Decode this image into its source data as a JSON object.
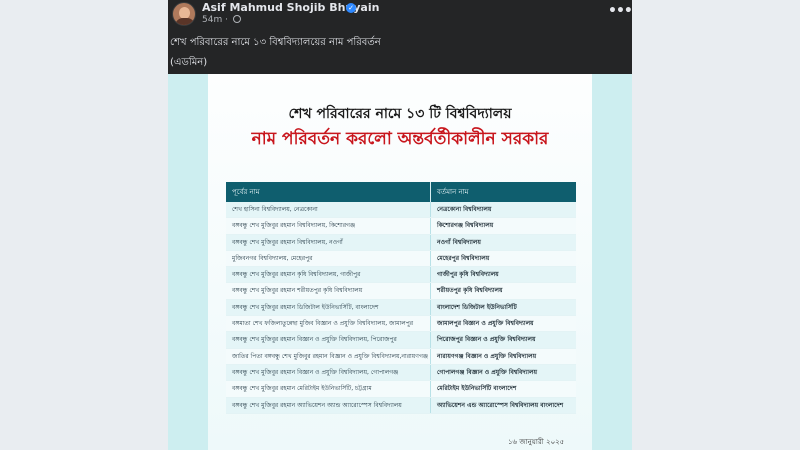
{
  "post": {
    "author": "Asif Mahmud Shojib Bhuyain",
    "time": "54m",
    "caption_line1": "শেখ পরিবারের নামে ১৩ বিশ্ববিদ্যালয়ের নাম পরিবর্তন",
    "caption_line2": "(এডমিন)",
    "more_label": "•••"
  },
  "graphic": {
    "headline1": "শেখ পরিবারের নামে ১৩ টি বিশ্ববিদ্যালয়",
    "headline2": "নাম পরিবর্তন করলো অন্তর্বর্তীকালীন সরকার",
    "headline2_color": "#c8161d",
    "header_color": "#0f5e6e",
    "col_old": "পূর্বের নাম",
    "col_new": "বর্তমান নাম",
    "rows": [
      {
        "old": "শেখ হাসিনা বিশ্ববিদ্যালয়, নেত্রকোনা",
        "new": "নেত্রকোনা বিশ্ববিদ্যালয়"
      },
      {
        "old": "বঙ্গবন্ধু শেখ মুজিবুর রহমান বিশ্ববিদ্যালয়, কিশোরগঞ্জ",
        "new": "কিশোরগঞ্জ বিশ্ববিদ্যালয়"
      },
      {
        "old": "বঙ্গবন্ধু শেখ মুজিবুর রহমান বিশ্ববিদ্যালয়, নওগাঁ",
        "new": "নওগাঁ বিশ্ববিদ্যালয়"
      },
      {
        "old": "মুজিবনগর বিশ্ববিদ্যালয়, মেহেরপুর",
        "new": "মেহেরপুর বিশ্ববিদ্যালয়"
      },
      {
        "old": "বঙ্গবন্ধু শেখ মুজিবুর রহমান কৃষি বিশ্ববিদ্যালয়, গাজীপুর",
        "new": "গাজীপুর কৃষি বিশ্ববিদ্যালয়"
      },
      {
        "old": "বঙ্গবন্ধু শেখ মুজিবুর রহমান শরীয়তপুর কৃষি বিশ্ববিদ্যালয়",
        "new": "শরীয়তপুর কৃষি বিশ্ববিদ্যালয়"
      },
      {
        "old": "বঙ্গবন্ধু শেখ মুজিবুর রহমান ডিজিটাল ইউনিভার্সিটি, বাংলাদেশ",
        "new": "বাংলাদেশ ডিজিটাল ইউনিভার্সিটি"
      },
      {
        "old": "বঙ্গমাতা শেখ ফজিলাতুন্নেছা মুজিব বিজ্ঞান ও প্রযুক্তি বিশ্ববিদ্যালয়, জামালপুর",
        "new": "জামালপুর বিজ্ঞান ও প্রযুক্তি বিশ্ববিদ্যালয়"
      },
      {
        "old": "বঙ্গবন্ধু শেখ মুজিবুর রহমান বিজ্ঞান ও প্রযুক্তি বিশ্ববিদ্যালয়, পিরোজপুর",
        "new": "পিরোজপুর বিজ্ঞান ও প্রযুক্তি বিশ্ববিদ্যালয়"
      },
      {
        "old": "জাতির পিতা বঙ্গবন্ধু শেখ মুজিবুর রহমান বিজ্ঞান ও প্রযুক্তি বিশ্ববিদ্যালয়,নারায়ণগঞ্জ",
        "new": "নারায়ণগঞ্জ বিজ্ঞান ও প্রযুক্তি বিশ্ববিদ্যালয়"
      },
      {
        "old": "বঙ্গবন্ধু শেখ মুজিবুর রহমান বিজ্ঞান ও প্রযুক্তি বিশ্ববিদ্যালয়, গোপালগঞ্জ",
        "new": "গোপালগঞ্জ বিজ্ঞান ও প্রযুক্তি বিশ্ববিদ্যালয়"
      },
      {
        "old": "বঙ্গবন্ধু শেখ মুজিবুর রহমান মেরিটাইম ইউনিভার্সিটি, চট্টগ্রাম",
        "new": "মেরিটাইম ইউনিভার্সিটি বাংলাদেশ"
      },
      {
        "old": "বঙ্গবন্ধু শেখ মুজিবুর রহমান অ্যাভিয়েশন অ্যান্ড অ্যারোস্পেস বিশ্ববিদ্যালয়",
        "new": "অ্যাভিয়েশন এন্ড অ্যারোস্পেস বিশ্ববিদ্যালয় বাংলাদেশ"
      }
    ],
    "date": "১৬ জানুয়ারী ২০২৫"
  }
}
